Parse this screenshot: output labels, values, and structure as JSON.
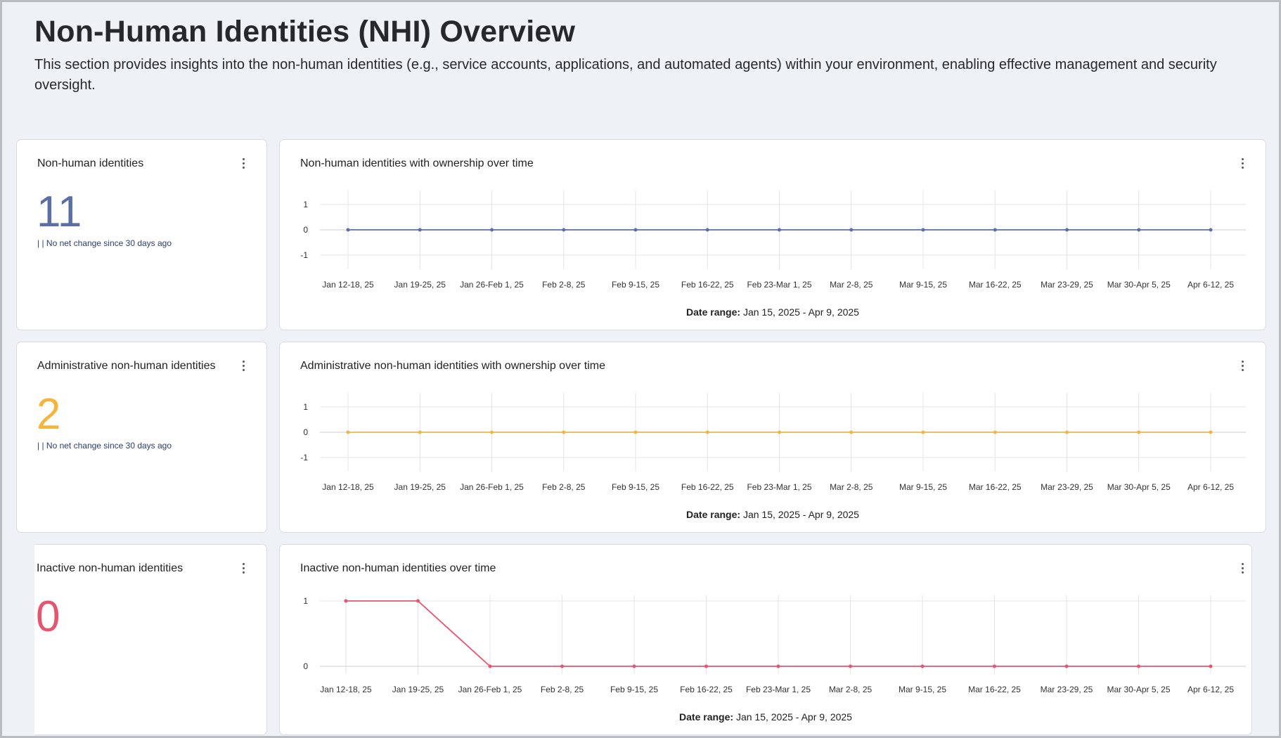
{
  "page": {
    "title": "Non-Human Identities (NHI) Overview",
    "description": "This section provides insights into the non-human identities (e.g., service accounts, applications, and automated agents) within your environment, enabling effective management and security oversight."
  },
  "cards": [
    {
      "title": "Non-human identities",
      "value": "11",
      "delta": "| | No net change since 30 days ago",
      "color": "#5a6fa8"
    },
    {
      "title": "Administrative non-human identities",
      "value": "2",
      "delta": "| | No net change since 30 days ago",
      "color": "#f5b43c"
    },
    {
      "title": "Inactive non-human identities",
      "value": "0",
      "delta": "",
      "color": "#e8546f"
    }
  ],
  "charts": [
    {
      "title": "Non-human identities with ownership over time",
      "date_range_label": "Date range:",
      "date_range": "Jan 15, 2025 - Apr 9, 2025"
    },
    {
      "title": "Administrative non-human identities with ownership over time",
      "date_range_label": "Date range:",
      "date_range": "Jan 15, 2025 - Apr 9, 2025"
    },
    {
      "title": "Inactive non-human identities over time",
      "date_range_label": "Date range:",
      "date_range": "Jan 15, 2025 - Apr 9, 2025"
    }
  ],
  "chart_data": [
    {
      "type": "line",
      "title": "Non-human identities with ownership over time",
      "categories": [
        "Jan 12-18, 25",
        "Jan 19-25, 25",
        "Jan 26-Feb 1, 25",
        "Feb 2-8, 25",
        "Feb 9-15, 25",
        "Feb 16-22, 25",
        "Feb 23-Mar 1, 25",
        "Mar 2-8, 25",
        "Mar 9-15, 25",
        "Mar 16-22, 25",
        "Mar 23-29, 25",
        "Mar 30-Apr 5, 25",
        "Apr 6-12, 25"
      ],
      "series": [
        {
          "values": [
            0,
            0,
            0,
            0,
            0,
            0,
            0,
            0,
            0,
            0,
            0,
            0,
            0
          ],
          "color": "#5a6fa8"
        }
      ],
      "yticks": [
        1,
        0,
        -1
      ],
      "ylim": [
        -1,
        1
      ],
      "grid": true
    },
    {
      "type": "line",
      "title": "Administrative non-human identities with ownership over time",
      "categories": [
        "Jan 12-18, 25",
        "Jan 19-25, 25",
        "Jan 26-Feb 1, 25",
        "Feb 2-8, 25",
        "Feb 9-15, 25",
        "Feb 16-22, 25",
        "Feb 23-Mar 1, 25",
        "Mar 2-8, 25",
        "Mar 9-15, 25",
        "Mar 16-22, 25",
        "Mar 23-29, 25",
        "Mar 30-Apr 5, 25",
        "Apr 6-12, 25"
      ],
      "series": [
        {
          "values": [
            0,
            0,
            0,
            0,
            0,
            0,
            0,
            0,
            0,
            0,
            0,
            0,
            0
          ],
          "color": "#f5b43c"
        }
      ],
      "yticks": [
        1,
        0,
        -1
      ],
      "ylim": [
        -1,
        1
      ],
      "grid": true
    },
    {
      "type": "line",
      "title": "Inactive non-human identities over time",
      "categories": [
        "Jan 12-18, 25",
        "Jan 19-25, 25",
        "Jan 26-Feb 1, 25",
        "Feb 2-8, 25",
        "Feb 9-15, 25",
        "Feb 16-22, 25",
        "Feb 23-Mar 1, 25",
        "Mar 2-8, 25",
        "Mar 9-15, 25",
        "Mar 16-22, 25",
        "Mar 23-29, 25",
        "Mar 30-Apr 5, 25",
        "Apr 6-12, 25"
      ],
      "series": [
        {
          "values": [
            1,
            1,
            0,
            0,
            0,
            0,
            0,
            0,
            0,
            0,
            0,
            0,
            0
          ],
          "color": "#e8546f"
        }
      ],
      "yticks": [
        1,
        0
      ],
      "ylim": [
        0,
        1
      ],
      "grid": true
    }
  ]
}
